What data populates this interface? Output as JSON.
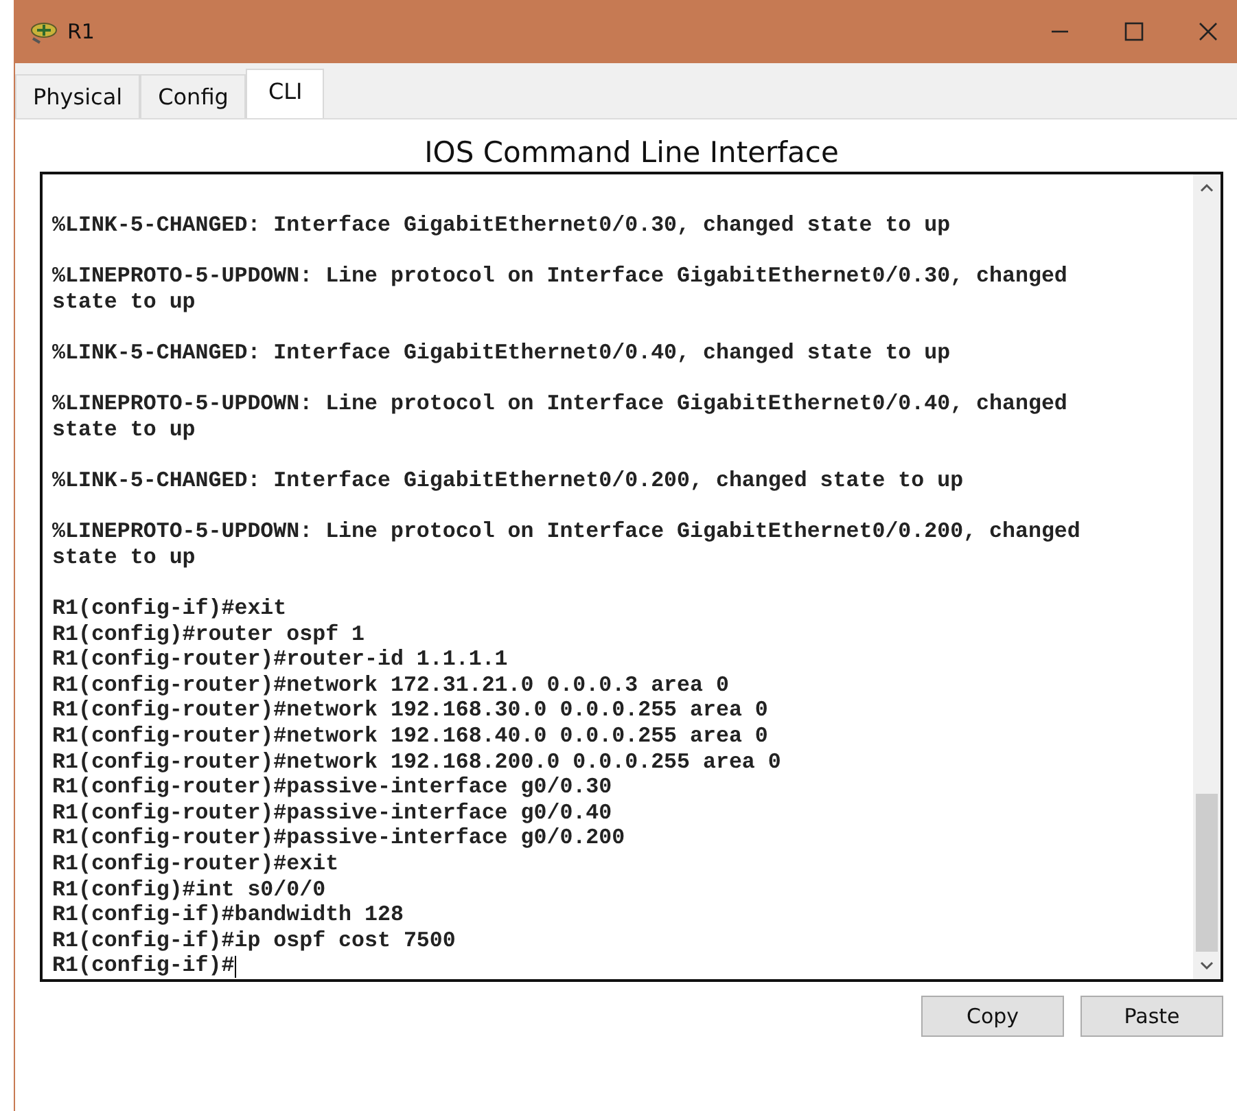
{
  "window": {
    "title": "R1"
  },
  "tabs": [
    {
      "label": "Physical",
      "selected": false
    },
    {
      "label": "Config",
      "selected": false
    },
    {
      "label": "CLI",
      "selected": true
    }
  ],
  "heading": "IOS Command Line Interface",
  "console": {
    "blocks": [
      {
        "lines": [
          "%LINK-5-CHANGED: Interface GigabitEthernet0/0.30, changed state to up"
        ]
      },
      {
        "lines": [
          "%LINEPROTO-5-UPDOWN: Line protocol on Interface GigabitEthernet0/0.30, changed",
          "state to up"
        ]
      },
      {
        "lines": [
          "%LINK-5-CHANGED: Interface GigabitEthernet0/0.40, changed state to up"
        ]
      },
      {
        "lines": [
          "%LINEPROTO-5-UPDOWN: Line protocol on Interface GigabitEthernet0/0.40, changed",
          "state to up"
        ]
      },
      {
        "lines": [
          "%LINK-5-CHANGED: Interface GigabitEthernet0/0.200, changed state to up"
        ]
      },
      {
        "lines": [
          "%LINEPROTO-5-UPDOWN: Line protocol on Interface GigabitEthernet0/0.200, changed",
          "state to up"
        ]
      },
      {
        "lines": [
          "R1(config-if)#exit",
          "R1(config)#router ospf 1",
          "R1(config-router)#router-id 1.1.1.1",
          "R1(config-router)#network 172.31.21.0 0.0.0.3 area 0",
          "R1(config-router)#network 192.168.30.0 0.0.0.255 area 0",
          "R1(config-router)#network 192.168.40.0 0.0.0.255 area 0",
          "R1(config-router)#network 192.168.200.0 0.0.0.255 area 0",
          "R1(config-router)#passive-interface g0/0.30",
          "R1(config-router)#passive-interface g0/0.40",
          "R1(config-router)#passive-interface g0/0.200",
          "R1(config-router)#exit",
          "R1(config)#int s0/0/0",
          "R1(config-if)#bandwidth 128",
          "R1(config-if)#ip ospf cost 7500"
        ]
      }
    ],
    "prompt": "R1(config-if)#"
  },
  "buttons": [
    "Copy",
    "Paste"
  ]
}
